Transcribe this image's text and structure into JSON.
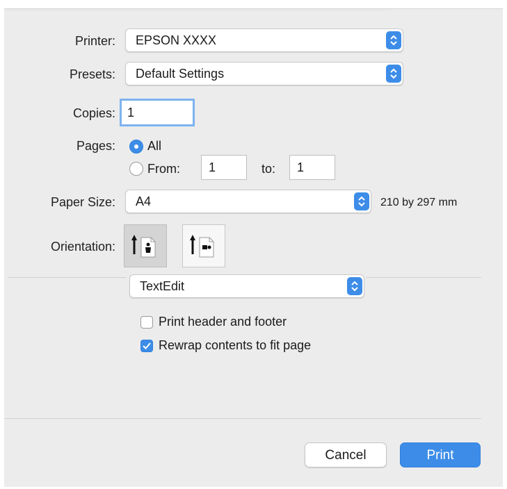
{
  "printer": {
    "label": "Printer:",
    "value": "EPSON XXXX"
  },
  "presets": {
    "label": "Presets:",
    "value": "Default Settings"
  },
  "copies": {
    "label": "Copies:",
    "value": "1"
  },
  "pages": {
    "label": "Pages:",
    "all_label": "All",
    "from_label": "From:",
    "from_value": "1",
    "to_label": "to:",
    "to_value": "1",
    "selected": "All"
  },
  "paper_size": {
    "label": "Paper Size:",
    "value": "A4",
    "dimensions": "210 by 297 mm"
  },
  "orientation": {
    "label": "Orientation:",
    "selected": "portrait"
  },
  "app_panel": {
    "value": "TextEdit"
  },
  "options": [
    {
      "label": "Print header and footer",
      "checked": false
    },
    {
      "label": "Rewrap contents to fit page",
      "checked": true
    }
  ],
  "buttons": {
    "cancel": "Cancel",
    "print": "Print"
  },
  "colors": {
    "accent": "#3d8de8",
    "background": "#ececec"
  },
  "icons": [
    "chevron-updown-icon",
    "portrait-orientation-icon",
    "landscape-orientation-icon",
    "checkmark-icon"
  ]
}
